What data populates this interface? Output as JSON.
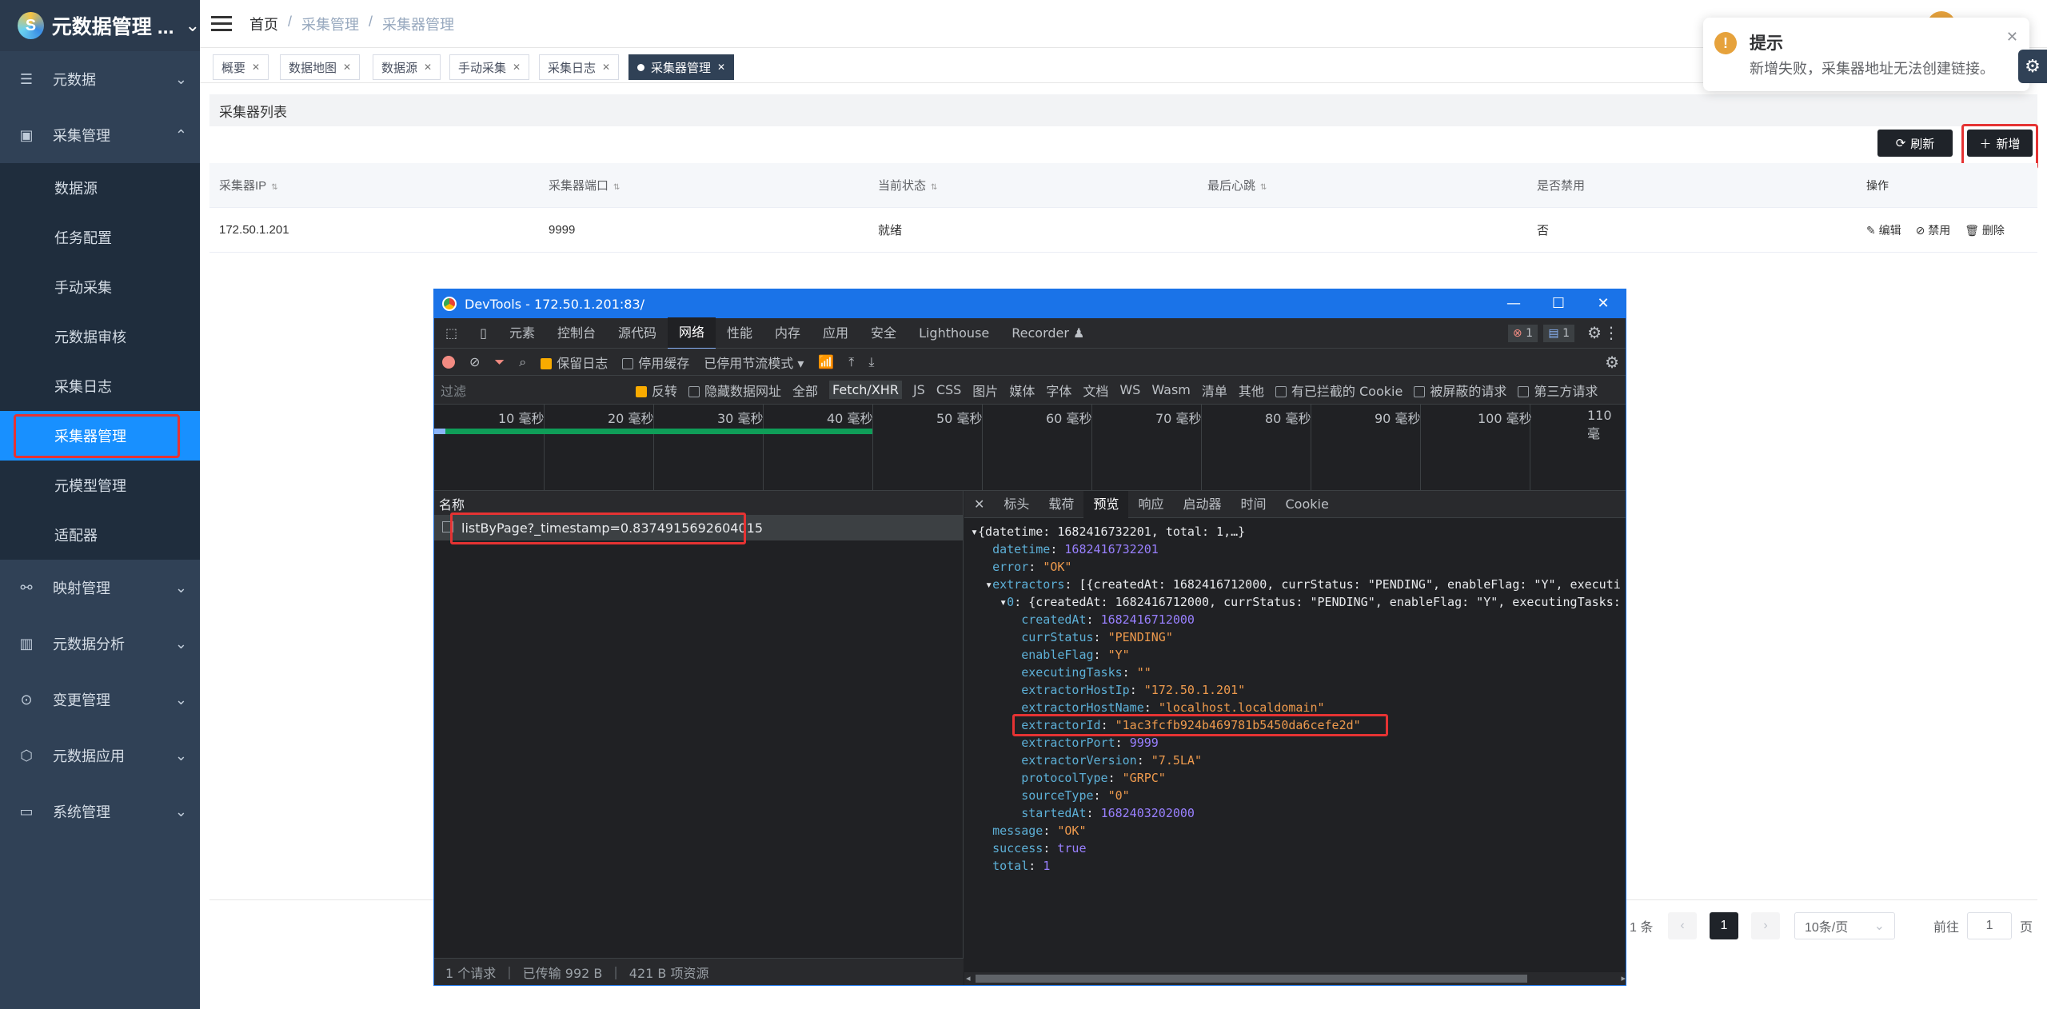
{
  "sidebar": {
    "app_title": "元数据管理 ...",
    "menu": [
      {
        "label": "元数据",
        "icon": "list-icon"
      },
      {
        "label": "采集管理",
        "icon": "archive-icon",
        "children": [
          "数据源",
          "任务配置",
          "手动采集",
          "元数据审核",
          "采集日志",
          "采集器管理",
          "元模型管理",
          "适配器"
        ]
      },
      {
        "label": "映射管理",
        "icon": "share-icon"
      },
      {
        "label": "元数据分析",
        "icon": "bar-chart-icon"
      },
      {
        "label": "变更管理",
        "icon": "location-icon"
      },
      {
        "label": "元数据应用",
        "icon": "cube-icon"
      },
      {
        "label": "系统管理",
        "icon": "monitor-icon"
      }
    ]
  },
  "header": {
    "breadcrumb": [
      "首页",
      "/",
      "采集管理",
      "/",
      "采集器管理"
    ]
  },
  "tags": [
    "概要",
    "数据地图",
    "数据源",
    "手动采集",
    "采集日志",
    "采集器管理"
  ],
  "main": {
    "panel_title": "采集器列表",
    "refresh_label": "刷新",
    "add_label": "新增",
    "columns": [
      "采集器IP",
      "采集器端口",
      "当前状态",
      "最后心跳",
      "是否禁用",
      "操作"
    ],
    "rows": [
      {
        "ip": "172.50.1.201",
        "port": "9999",
        "status": "就绪",
        "heartbeat": "",
        "disabled": "否"
      }
    ],
    "ops": [
      "编辑",
      "禁用",
      "删除"
    ],
    "pager": {
      "total": "1 条",
      "page": "1",
      "size": "10条/页",
      "goto_prefix": "前往",
      "goto_value": "1",
      "goto_suffix": "页"
    }
  },
  "notification": {
    "title": "提示",
    "message": "新增失败，采集器地址无法创建链接。"
  },
  "devtools": {
    "window_title": "DevTools - 172.50.1.201:83/",
    "tabs": [
      "元素",
      "控制台",
      "源代码",
      "网络",
      "性能",
      "内存",
      "应用",
      "安全",
      "Lighthouse",
      "Recorder"
    ],
    "error_count": "1",
    "message_count": "1",
    "toolbar": {
      "preserve_log": "保留日志",
      "disable_cache": "停用缓存",
      "throttle": "已停用节流模式"
    },
    "filter": {
      "placeholder": "过滤",
      "invert": "反转",
      "hide_data_urls": "隐藏数据网址",
      "types": [
        "全部",
        "Fetch/XHR",
        "JS",
        "CSS",
        "图片",
        "媒体",
        "字体",
        "文档",
        "WS",
        "Wasm",
        "清单",
        "其他"
      ],
      "blocked_cookies": "有已拦截的 Cookie",
      "blocked_requests": "被屏蔽的请求",
      "third_party": "第三方请求"
    },
    "timeline_labels": [
      "10 毫秒",
      "20 毫秒",
      "30 毫秒",
      "40 毫秒",
      "50 毫秒",
      "60 毫秒",
      "70 毫秒",
      "80 毫秒",
      "90 毫秒",
      "100 毫秒",
      "110 毫"
    ],
    "request_list": {
      "header": "名称",
      "request": "listByPage?_timestamp=0.8374915692604015"
    },
    "status": {
      "requests": "1 个请求",
      "transferred": "已传输 992 B",
      "resources": "421 B 项资源"
    },
    "detail_tabs": [
      "标头",
      "载荷",
      "预览",
      "响应",
      "启动器",
      "时间",
      "Cookie"
    ],
    "preview": {
      "summary": "{datetime: 1682416732201, total: 1,…}",
      "datetime": "1682416732201",
      "error": "\"OK\"",
      "extractors_summary": "[{createdAt: 1682416712000, currStatus: \"PENDING\", enableFlag: \"Y\", executi",
      "item_summary": "{createdAt: 1682416712000, currStatus: \"PENDING\", enableFlag: \"Y\", executingTasks:",
      "createdAt": "1682416712000",
      "currStatus": "\"PENDING\"",
      "enableFlag": "\"Y\"",
      "executingTasks": "\"\"",
      "extractorHostIp": "\"172.50.1.201\"",
      "extractorHostName": "\"localhost.localdomain\"",
      "extractorId": "\"1ac3fcfb924b469781b5450da6cefe2d\"",
      "extractorPort": "9999",
      "extractorVersion": "\"7.5LA\"",
      "protocolType": "\"GRPC\"",
      "sourceType": "\"0\"",
      "startedAt": "1682403202000",
      "message": "\"OK\"",
      "success": "true",
      "total": "1"
    }
  }
}
